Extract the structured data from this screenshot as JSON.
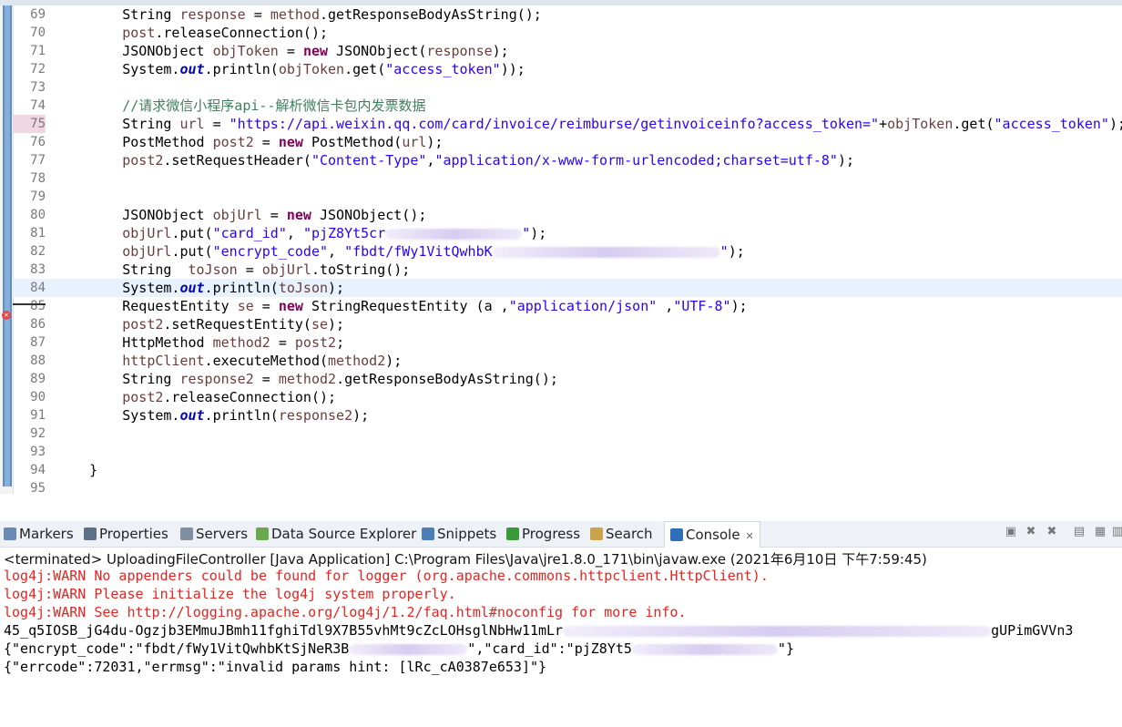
{
  "editor": {
    "lines": [
      {
        "n": "69",
        "parts": [
          [
            "t",
            "        String "
          ],
          [
            "var",
            "response"
          ],
          [
            "t",
            " = "
          ],
          [
            "var",
            "method"
          ],
          [
            "t",
            ".getResponseBodyAsString();"
          ]
        ]
      },
      {
        "n": "70",
        "parts": [
          [
            "t",
            "        "
          ],
          [
            "var",
            "post"
          ],
          [
            "t",
            ".releaseConnection();"
          ]
        ]
      },
      {
        "n": "71",
        "parts": [
          [
            "t",
            "        JSONObject "
          ],
          [
            "var",
            "objToken"
          ],
          [
            "t",
            " = "
          ],
          [
            "kw",
            "new"
          ],
          [
            "t",
            " JSONObject("
          ],
          [
            "var",
            "response"
          ],
          [
            "t",
            ");"
          ]
        ]
      },
      {
        "n": "72",
        "parts": [
          [
            "t",
            "        System."
          ],
          [
            "sf",
            "out"
          ],
          [
            "t",
            ".println("
          ],
          [
            "var",
            "objToken"
          ],
          [
            "t",
            ".get("
          ],
          [
            "str",
            "\"access_token\""
          ],
          [
            "t",
            "));"
          ]
        ]
      },
      {
        "n": "73",
        "parts": []
      },
      {
        "n": "74",
        "parts": [
          [
            "t",
            "        "
          ],
          [
            "cm",
            "//请求微信小程序api--解析微信卡包内发票数据"
          ]
        ]
      },
      {
        "n": "75",
        "bp": true,
        "parts": [
          [
            "t",
            "        String "
          ],
          [
            "var",
            "url"
          ],
          [
            "t",
            " = "
          ],
          [
            "str",
            "\"https://api.weixin.qq.com/card/invoice/reimburse/getinvoiceinfo?access_token=\""
          ],
          [
            "t",
            "+"
          ],
          [
            "var",
            "objToken"
          ],
          [
            "t",
            ".get("
          ],
          [
            "str",
            "\"access_token\""
          ],
          [
            "t",
            ");"
          ]
        ]
      },
      {
        "n": "76",
        "parts": [
          [
            "t",
            "        PostMethod "
          ],
          [
            "var",
            "post2"
          ],
          [
            "t",
            " = "
          ],
          [
            "kw",
            "new"
          ],
          [
            "t",
            " PostMethod("
          ],
          [
            "var",
            "url"
          ],
          [
            "t",
            ");"
          ]
        ]
      },
      {
        "n": "77",
        "parts": [
          [
            "t",
            "        "
          ],
          [
            "var",
            "post2"
          ],
          [
            "t",
            ".setRequestHeader("
          ],
          [
            "str",
            "\"Content-Type\""
          ],
          [
            "t",
            ","
          ],
          [
            "str",
            "\"application/x-www-form-urlencoded;charset=utf-8\""
          ],
          [
            "t",
            ");"
          ]
        ]
      },
      {
        "n": "78",
        "parts": []
      },
      {
        "n": "79",
        "parts": []
      },
      {
        "n": "80",
        "parts": [
          [
            "t",
            "        JSONObject "
          ],
          [
            "var",
            "objUrl"
          ],
          [
            "t",
            " = "
          ],
          [
            "kw",
            "new"
          ],
          [
            "t",
            " JSONObject();"
          ]
        ]
      },
      {
        "n": "81",
        "parts": [
          [
            "t",
            "        "
          ],
          [
            "var",
            "objUrl"
          ],
          [
            "t",
            ".put("
          ],
          [
            "str",
            "\"card_id\""
          ],
          [
            "t",
            ", "
          ],
          [
            "str",
            "\"pjZ8Yt5cr"
          ],
          [
            "blur",
            "150"
          ],
          [
            "str",
            "\""
          ],
          [
            "t",
            ");"
          ]
        ]
      },
      {
        "n": "82",
        "parts": [
          [
            "t",
            "        "
          ],
          [
            "var",
            "objUrl"
          ],
          [
            "t",
            ".put("
          ],
          [
            "str",
            "\"encrypt_code\""
          ],
          [
            "t",
            ", "
          ],
          [
            "str",
            "\"fbdt/fWy1VitQwhbK"
          ],
          [
            "blur",
            "250"
          ],
          [
            "str",
            "\""
          ],
          [
            "t",
            ");"
          ]
        ]
      },
      {
        "n": "83",
        "parts": [
          [
            "t",
            "        String  "
          ],
          [
            "var",
            "toJson"
          ],
          [
            "t",
            " = "
          ],
          [
            "var",
            "objUrl"
          ],
          [
            "t",
            ".toString();"
          ]
        ]
      },
      {
        "n": "84",
        "cur": true,
        "parts": [
          [
            "t",
            "        System."
          ],
          [
            "sf",
            "out"
          ],
          [
            "t",
            ".println("
          ],
          [
            "var",
            "toJson"
          ],
          [
            "t",
            ");"
          ]
        ]
      },
      {
        "n": "85",
        "parts": [
          [
            "t",
            "        RequestEntity "
          ],
          [
            "var",
            "se"
          ],
          [
            "t",
            " = "
          ],
          [
            "kw",
            "new"
          ],
          [
            "t",
            " StringRequestEntity (a ,"
          ],
          [
            "str",
            "\"application/json\""
          ],
          [
            "t",
            " ,"
          ],
          [
            "str",
            "\"UTF-8\""
          ],
          [
            "t",
            ");"
          ]
        ]
      },
      {
        "n": "86",
        "parts": [
          [
            "t",
            "        "
          ],
          [
            "var",
            "post2"
          ],
          [
            "t",
            ".setRequestEntity("
          ],
          [
            "var",
            "se"
          ],
          [
            "t",
            ");"
          ]
        ]
      },
      {
        "n": "87",
        "parts": [
          [
            "t",
            "        HttpMethod "
          ],
          [
            "var",
            "method2"
          ],
          [
            "t",
            " = "
          ],
          [
            "var",
            "post2"
          ],
          [
            "t",
            ";"
          ]
        ]
      },
      {
        "n": "88",
        "parts": [
          [
            "t",
            "        "
          ],
          [
            "var",
            "httpClient"
          ],
          [
            "t",
            ".executeMethod("
          ],
          [
            "var",
            "method2"
          ],
          [
            "t",
            ");"
          ]
        ]
      },
      {
        "n": "89",
        "parts": [
          [
            "t",
            "        String "
          ],
          [
            "var",
            "response2"
          ],
          [
            "t",
            " = "
          ],
          [
            "var",
            "method2"
          ],
          [
            "t",
            ".getResponseBodyAsString();"
          ]
        ]
      },
      {
        "n": "90",
        "parts": [
          [
            "t",
            "        "
          ],
          [
            "var",
            "post2"
          ],
          [
            "t",
            ".releaseConnection();"
          ]
        ]
      },
      {
        "n": "91",
        "parts": [
          [
            "t",
            "        System."
          ],
          [
            "sf",
            "out"
          ],
          [
            "t",
            ".println("
          ],
          [
            "var",
            "response2"
          ],
          [
            "t",
            ");"
          ]
        ]
      },
      {
        "n": "92",
        "parts": []
      },
      {
        "n": "93",
        "parts": []
      },
      {
        "n": "94",
        "parts": [
          [
            "t",
            "    }"
          ]
        ]
      },
      {
        "n": "95",
        "parts": []
      }
    ]
  },
  "views": {
    "tabs": [
      {
        "label": "Markers",
        "icon": "markers-icon",
        "color": "#6a8ab5"
      },
      {
        "label": "Properties",
        "icon": "properties-icon",
        "color": "#5b6f87"
      },
      {
        "label": "Servers",
        "icon": "servers-icon",
        "color": "#7f8f9f"
      },
      {
        "label": "Data Source Explorer",
        "icon": "data-source-icon",
        "color": "#6aa84f"
      },
      {
        "label": "Snippets",
        "icon": "snippets-icon",
        "color": "#4b7eb5"
      },
      {
        "label": "Progress",
        "icon": "progress-icon",
        "color": "#3a9a3a"
      },
      {
        "label": "Search",
        "icon": "search-icon",
        "color": "#c9a24a"
      },
      {
        "label": "Console",
        "icon": "console-icon",
        "color": "#2f6fb8"
      }
    ],
    "close_glyph": "✕"
  },
  "console": {
    "terminated": "<terminated> UploadingFileController [Java Application] C:\\Program Files\\Java\\jre1.8.0_171\\bin\\javaw.exe (2021年6月10日 下午7:59:45)",
    "lines": [
      {
        "text": "log4j:WARN No appenders could be found for logger (org.apache.commons.httpclient.HttpClient).",
        "red": true
      },
      {
        "text": "log4j:WARN Please initialize the log4j system properly.",
        "red": true
      },
      {
        "text": "log4j:WARN See http://logging.apache.org/log4j/1.2/faq.html#noconfig for more info.",
        "red": true
      },
      {
        "text": "45_q5IOSB_jG4du-Ogzjb3EMmuJBmh11fghiTdl9X7B55vhMt9cZcLOHsglNbHw11mLr",
        "red": false,
        "tail": "gUPimGVVn3"
      },
      {
        "text": "{\"encrypt_code\":\"fbdt/fWy1VitQwhbKtSjNeR3B",
        "red": false,
        "tail2": "\",\"card_id\":\"pjZ8Yt5",
        "tail3": "\"}"
      },
      {
        "text": "{\"errcode\":72031,\"errmsg\":\"invalid params hint: [lRc_cA0387e653]\"}",
        "red": false
      }
    ]
  }
}
